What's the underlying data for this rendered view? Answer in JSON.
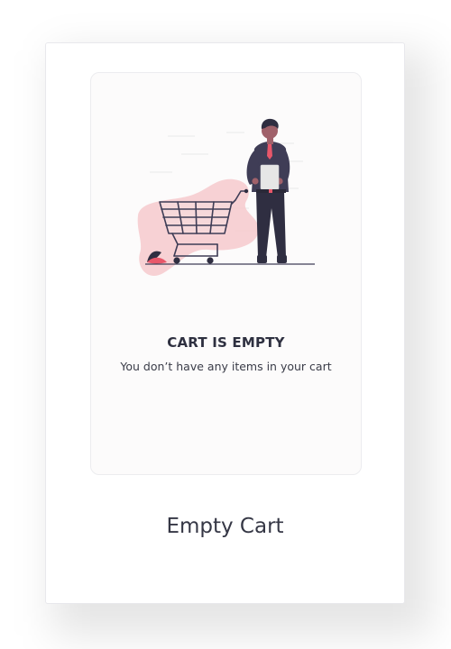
{
  "empty_state": {
    "heading": "CART IS EMPTY",
    "message": "You don’t have any items in your cart",
    "illustration": "person-with-shopping-cart-illustration"
  },
  "caption": {
    "title": "Empty Cart"
  },
  "colors": {
    "accent": "#f2b8bd",
    "figure_dark": "#2f2e41",
    "tie": "#e8576a",
    "leaf_red": "#e8576a",
    "leaf_dark": "#2f2e41",
    "panel_bg": "#fcfbfb"
  }
}
